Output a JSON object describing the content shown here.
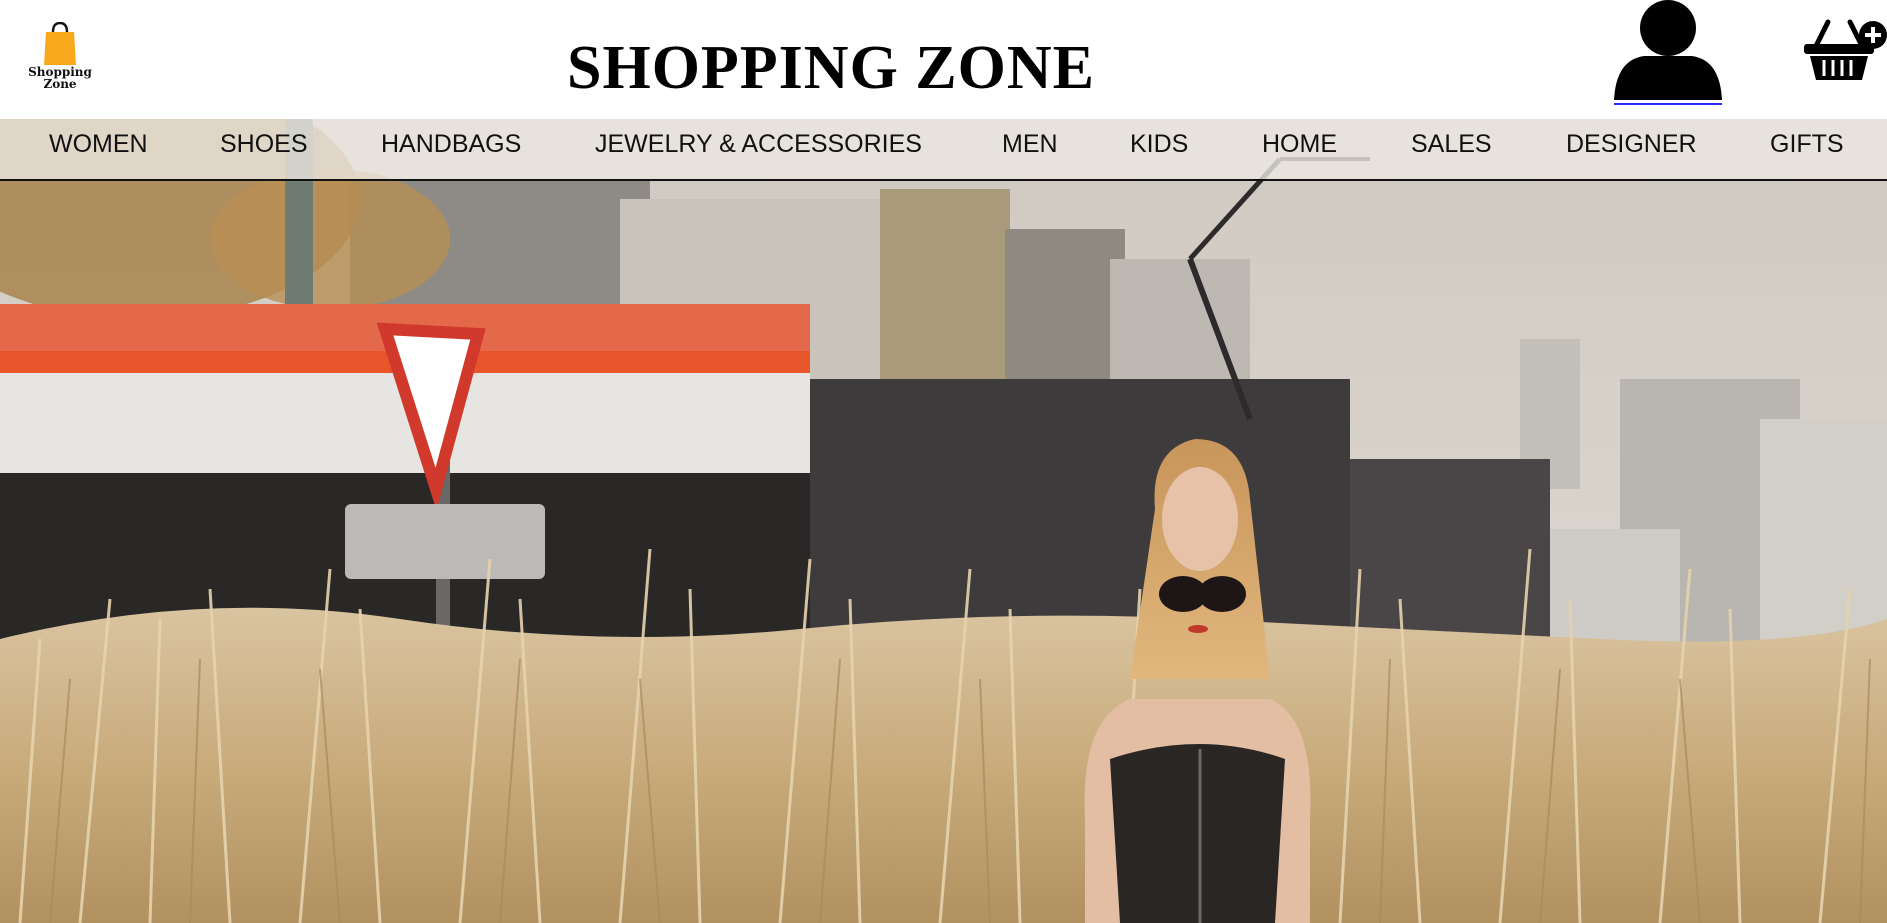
{
  "header": {
    "logo_text_line1": "Shopping",
    "logo_text_line2": "Zone",
    "site_title": "SHOPPING ZONE"
  },
  "icons": {
    "logo": "shopping-bag-icon",
    "account": "user-icon",
    "cart": "basket-add-icon"
  },
  "nav": {
    "items": [
      {
        "label": "WOMEN"
      },
      {
        "label": "SHOES"
      },
      {
        "label": "HANDBAGS"
      },
      {
        "label": "JEWELRY & ACCESSORIES"
      },
      {
        "label": "MEN"
      },
      {
        "label": "KIDS"
      },
      {
        "label": "HOME"
      },
      {
        "label": "SALES"
      },
      {
        "label": "DESIGNER"
      },
      {
        "label": "GIFTS"
      }
    ]
  },
  "colors": {
    "logo_bag": "#f7a81b",
    "nav_background": "#ece8e2",
    "text": "#111111",
    "tram_stripe": "#e8552a"
  }
}
